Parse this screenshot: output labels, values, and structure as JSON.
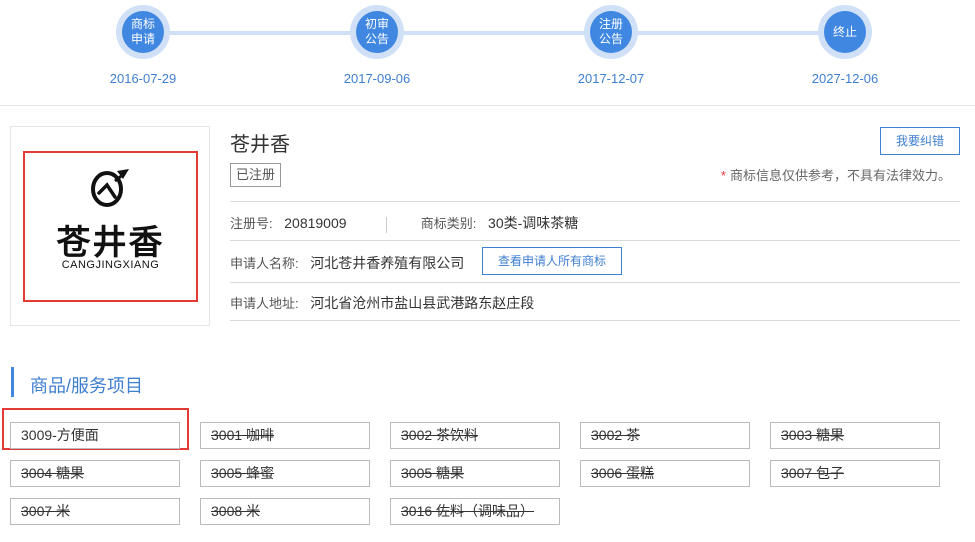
{
  "timeline": [
    {
      "label": "商标\n申请",
      "date": "2016-07-29"
    },
    {
      "label": "初审\n公告",
      "date": "2017-09-06"
    },
    {
      "label": "注册\n公告",
      "date": "2017-12-07"
    },
    {
      "label": "终止",
      "date": "2027-12-06"
    }
  ],
  "logo": {
    "cn_text": "苍井香",
    "en_text": "CANGJINGXIANG"
  },
  "trademark": {
    "name": "苍井香",
    "status": "已注册",
    "report_button": "我要纠错",
    "disclaimer_star": "*",
    "disclaimer": "商标信息仅供参考，不具有法律效力。",
    "reg_no_label": "注册号:",
    "reg_no": "20819009",
    "class_label": "商标类别:",
    "class_value": "30类-调味茶糖",
    "applicant_label": "申请人名称:",
    "applicant": "河北苍井香养殖有限公司",
    "applicant_button": "查看申请人所有商标",
    "address_label": "申请人地址:",
    "address": "河北省沧州市盐山县武港路东赵庄段"
  },
  "goods_section": {
    "title": "商品/服务项目",
    "items": [
      {
        "text": "3009-方便面",
        "struck": false
      },
      {
        "text": "3001 咖啡",
        "struck": true
      },
      {
        "text": "3002 茶饮料",
        "struck": true
      },
      {
        "text": "3002 茶",
        "struck": true
      },
      {
        "text": "3003 糖果",
        "struck": true
      },
      {
        "text": "3004 糖果",
        "struck": true
      },
      {
        "text": "3005 蜂蜜",
        "struck": true
      },
      {
        "text": "3005 糖果",
        "struck": true
      },
      {
        "text": "3006 蛋糕",
        "struck": true
      },
      {
        "text": "3007 包子",
        "struck": true
      },
      {
        "text": "3007 米",
        "struck": true
      },
      {
        "text": "3008 米",
        "struck": true
      },
      {
        "text": "3016 佐料（调味品）",
        "struck": true
      }
    ]
  },
  "colors": {
    "accent": "#3f87e0",
    "accent_light": "#cfe0f7",
    "highlight_red": "#e53935"
  }
}
